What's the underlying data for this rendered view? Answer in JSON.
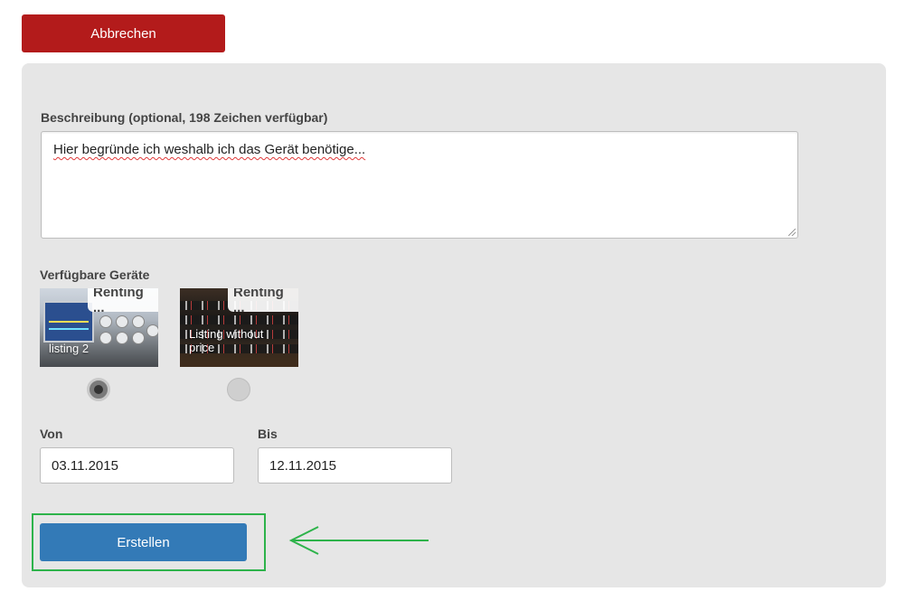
{
  "actions": {
    "cancel_label": "Abbrechen",
    "create_label": "Erstellen"
  },
  "form": {
    "description_label": "Beschreibung (optional, 198 Zeichen verfügbar)",
    "description_value": "Hier begründe ich weshalb ich das Gerät benötige...",
    "devices_label": "Verfügbare Geräte",
    "devices": [
      {
        "badge": "Renting ...",
        "title": "listing 2",
        "selected": true,
        "image_icon": "oscilloscope-image"
      },
      {
        "badge": "Renting ...",
        "title": "Listing without price",
        "selected": false,
        "image_icon": "equipment-rack-image"
      }
    ],
    "from_label": "Von",
    "from_value": "03.11.2015",
    "to_label": "Bis",
    "to_value": "12.11.2015"
  },
  "colors": {
    "cancel": "#b31b1b",
    "primary": "#337ab7",
    "highlight": "#2db34a",
    "panel": "#e6e6e6"
  }
}
